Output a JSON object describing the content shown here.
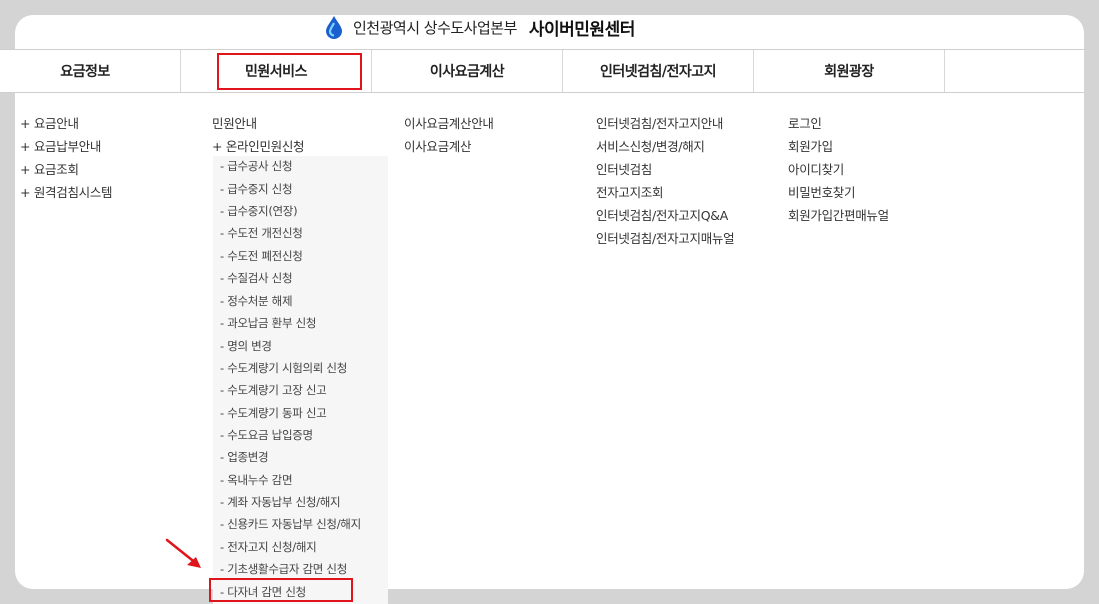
{
  "header": {
    "org_name": "인천광역시 상수도사업본부",
    "site_name": "사이버민원센터"
  },
  "gnb": [
    {
      "label": "요금정보"
    },
    {
      "label": "민원서비스"
    },
    {
      "label": "이사요금계산"
    },
    {
      "label": "인터넷검침/전자고지"
    },
    {
      "label": "회원광장"
    }
  ],
  "menu": {
    "fee_info": [
      "+ 요금안내",
      "+ 요금납부안내",
      "+ 요금조회",
      "+ 원격검침시스템"
    ],
    "civil_service": [
      "민원안내",
      "+ 온라인민원신청"
    ],
    "civil_sub": [
      "- 급수공사 신청",
      "- 급수중지 신청",
      "- 급수중지(연장)",
      "- 수도전 개전신청",
      "- 수도전 폐전신청",
      "- 수질검사 신청",
      "- 정수처분 해제",
      "- 과오납금 환부 신청",
      "- 명의 변경",
      "- 수도계량기 시험의뢰 신청",
      "- 수도계량기 고장 신고",
      "- 수도계량기 동파 신고",
      "- 수도요금 납입증명",
      "- 업종변경",
      "- 옥내누수 감면",
      "- 계좌 자동납부 신청/해지",
      "- 신용카드 자동납부 신청/해지",
      "- 전자고지 신청/해지",
      "- 기초생활수급자 감면 신청",
      "- 다자녀 감면 신청"
    ],
    "moving_fee": [
      "이사요금계산안내",
      "이사요금계산"
    ],
    "internet": [
      "인터넷검침/전자고지안내",
      "서비스신청/변경/해지",
      "인터넷검침",
      "전자고지조회",
      "인터넷검침/전자고지Q&A",
      "인터넷검침/전자고지매뉴얼"
    ],
    "members": [
      "로그인",
      "회원가입",
      "아이디찾기",
      "비밀번호찾기",
      "회원가입간편매뉴얼"
    ]
  },
  "colors": {
    "highlight": "#e0151b",
    "brand_blue": "#1a5fd0",
    "background": "#d4d4d4"
  },
  "icons": {
    "logo": "water-drop-icon",
    "pointer": "red-arrow-icon"
  }
}
